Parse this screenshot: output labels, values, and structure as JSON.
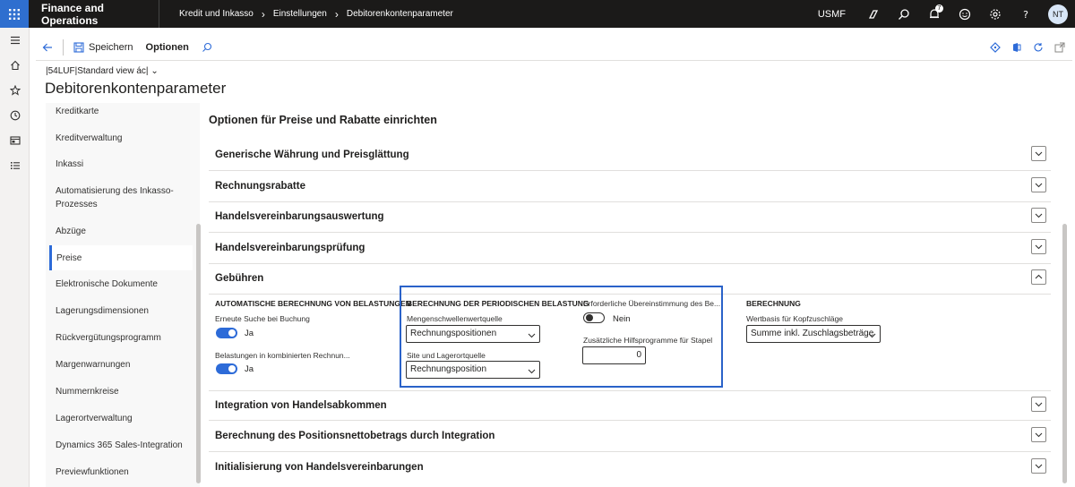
{
  "topbar": {
    "app_title": "Finance and Operations",
    "breadcrumb": [
      "Kredit und Inkasso",
      "Einstellungen",
      "Debitorenkontenparameter"
    ],
    "company": "USMF",
    "notification_count": "7",
    "avatar_initials": "NT"
  },
  "actionpane": {
    "save_label": "Speichern",
    "options_label": "Optionen"
  },
  "header": {
    "view": "|54LUF|Standard view ác|",
    "title": "Debitorenkontenparameter"
  },
  "nav": {
    "items": [
      "Kreditkarte",
      "Kreditverwaltung",
      "Inkassi",
      "Automatisierung des Inkasso-Prozesses",
      "Abzüge",
      "Preise",
      "Elektronische Dokumente",
      "Lagerungsdimensionen",
      "Rückvergütungsprogramm",
      "Margenwarnungen",
      "Nummernkreise",
      "Lagerortverwaltung",
      "Dynamics 365 Sales-Integration",
      "Previewfunktionen"
    ],
    "active": "Preise"
  },
  "main": {
    "section_title": "Optionen für Preise und Rabatte einrichten",
    "fasttabs": [
      "Generische Währung und Preisglättung",
      "Rechnungsrabatte",
      "Handelsvereinbarungsauswertung",
      "Handelsvereinbarungsprüfung",
      "Gebühren",
      "Integration von Handelsabkommen",
      "Berechnung des Positionsnettobetrags durch Integration",
      "Initialisierung von Handelsvereinbarungen"
    ],
    "charges": {
      "auto_group": "AUTOMATISCHE BERECHNUNG VON BELASTUNGEN",
      "research_label": "Erneute Suche bei Buchung",
      "research_value": "Ja",
      "combined_label": "Belastungen in kombinierten Rechnun...",
      "combined_value": "Ja",
      "periodic_group": "BERECHNUNG DER PERIODISCHEN BELASTUNG",
      "qty_source_label": "Mengenschwellenwertquelle",
      "qty_source_value": "Rechnungspositionen",
      "site_source_label": "Site und Lagerortquelle",
      "site_source_value": "Rechnungsposition",
      "match_label": "Erforderliche Übereinstimmung des Be...",
      "match_value": "Nein",
      "helpers_label": "Zusätzliche Hilfsprogramme für Stapel",
      "helpers_value": "0",
      "calc_group": "BERECHNUNG",
      "header_basis_label": "Wertbasis für Kopfzuschläge",
      "header_basis_value": "Summe inkl. Zuschlagsbeträge"
    }
  }
}
